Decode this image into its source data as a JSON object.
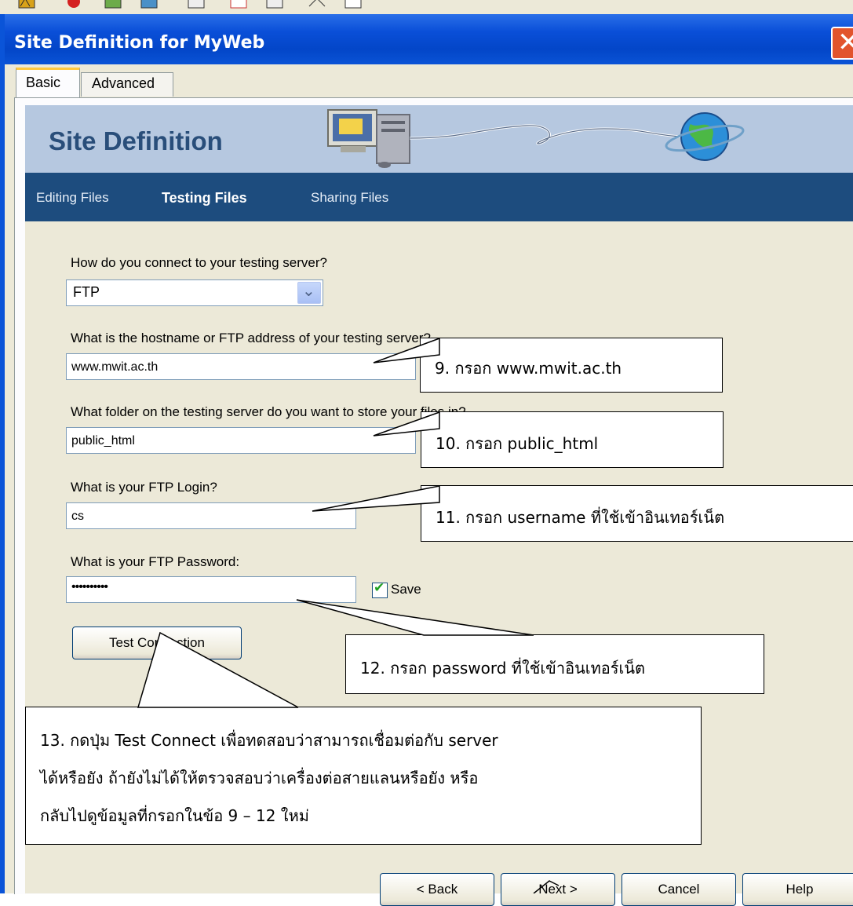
{
  "window": {
    "title": "Site Definition for MyWeb"
  },
  "tabs": [
    {
      "label": "Basic"
    },
    {
      "label": "Advanced"
    }
  ],
  "banner": {
    "title": "Site Definition"
  },
  "nav": {
    "items": [
      {
        "label": "Editing Files"
      },
      {
        "label": "Testing Files"
      },
      {
        "label": "Sharing Files"
      }
    ]
  },
  "form": {
    "connect_question": "How do you connect to your testing server?",
    "connect_value": "FTP",
    "host_question": "What is the hostname or FTP address of your testing server?",
    "host_value": "www.mwit.ac.th",
    "folder_question": "What folder on the testing server do you want to store your files in?",
    "folder_value": "public_html",
    "login_question": "What is your FTP Login?",
    "login_value": "cs",
    "password_question": "What is your FTP Password:",
    "password_value": "••••••••••",
    "save_label": "Save",
    "save_checked": true,
    "test_button": "Test Connection"
  },
  "buttons": {
    "back": "< Back",
    "next": "Next >",
    "cancel": "Cancel",
    "help": "Help"
  },
  "callouts": {
    "c9": "9.  กรอก www.mwit.ac.th",
    "c10": "10.  กรอก public_html",
    "c11": "11.  กรอก username ที่ใช้เข้าอินเทอร์เน็ต",
    "c12": "12.  กรอก password ที่ใช้เข้าอินเทอร์เน็ต",
    "c13_line1": "13.  กดปุ่ม Test Connect เพื่อทดสอบว่าสามารถเชื่อมต่อกับ server",
    "c13_line2": "ได้หรือยัง  ถ้ายังไม่ได้ให้ตรวจสอบว่าเครื่องต่อสายแลนหรือยัง  หรือ",
    "c13_line3": "กลับไปดูข้อมูลที่กรอกในข้อ 9 – 12 ใหม่"
  },
  "colors": {
    "title_bar": "#0346c8",
    "banner_bg": "#b6c8e0",
    "nav_bg": "#1d4c7e",
    "dialog_bg": "#ece9d8"
  }
}
